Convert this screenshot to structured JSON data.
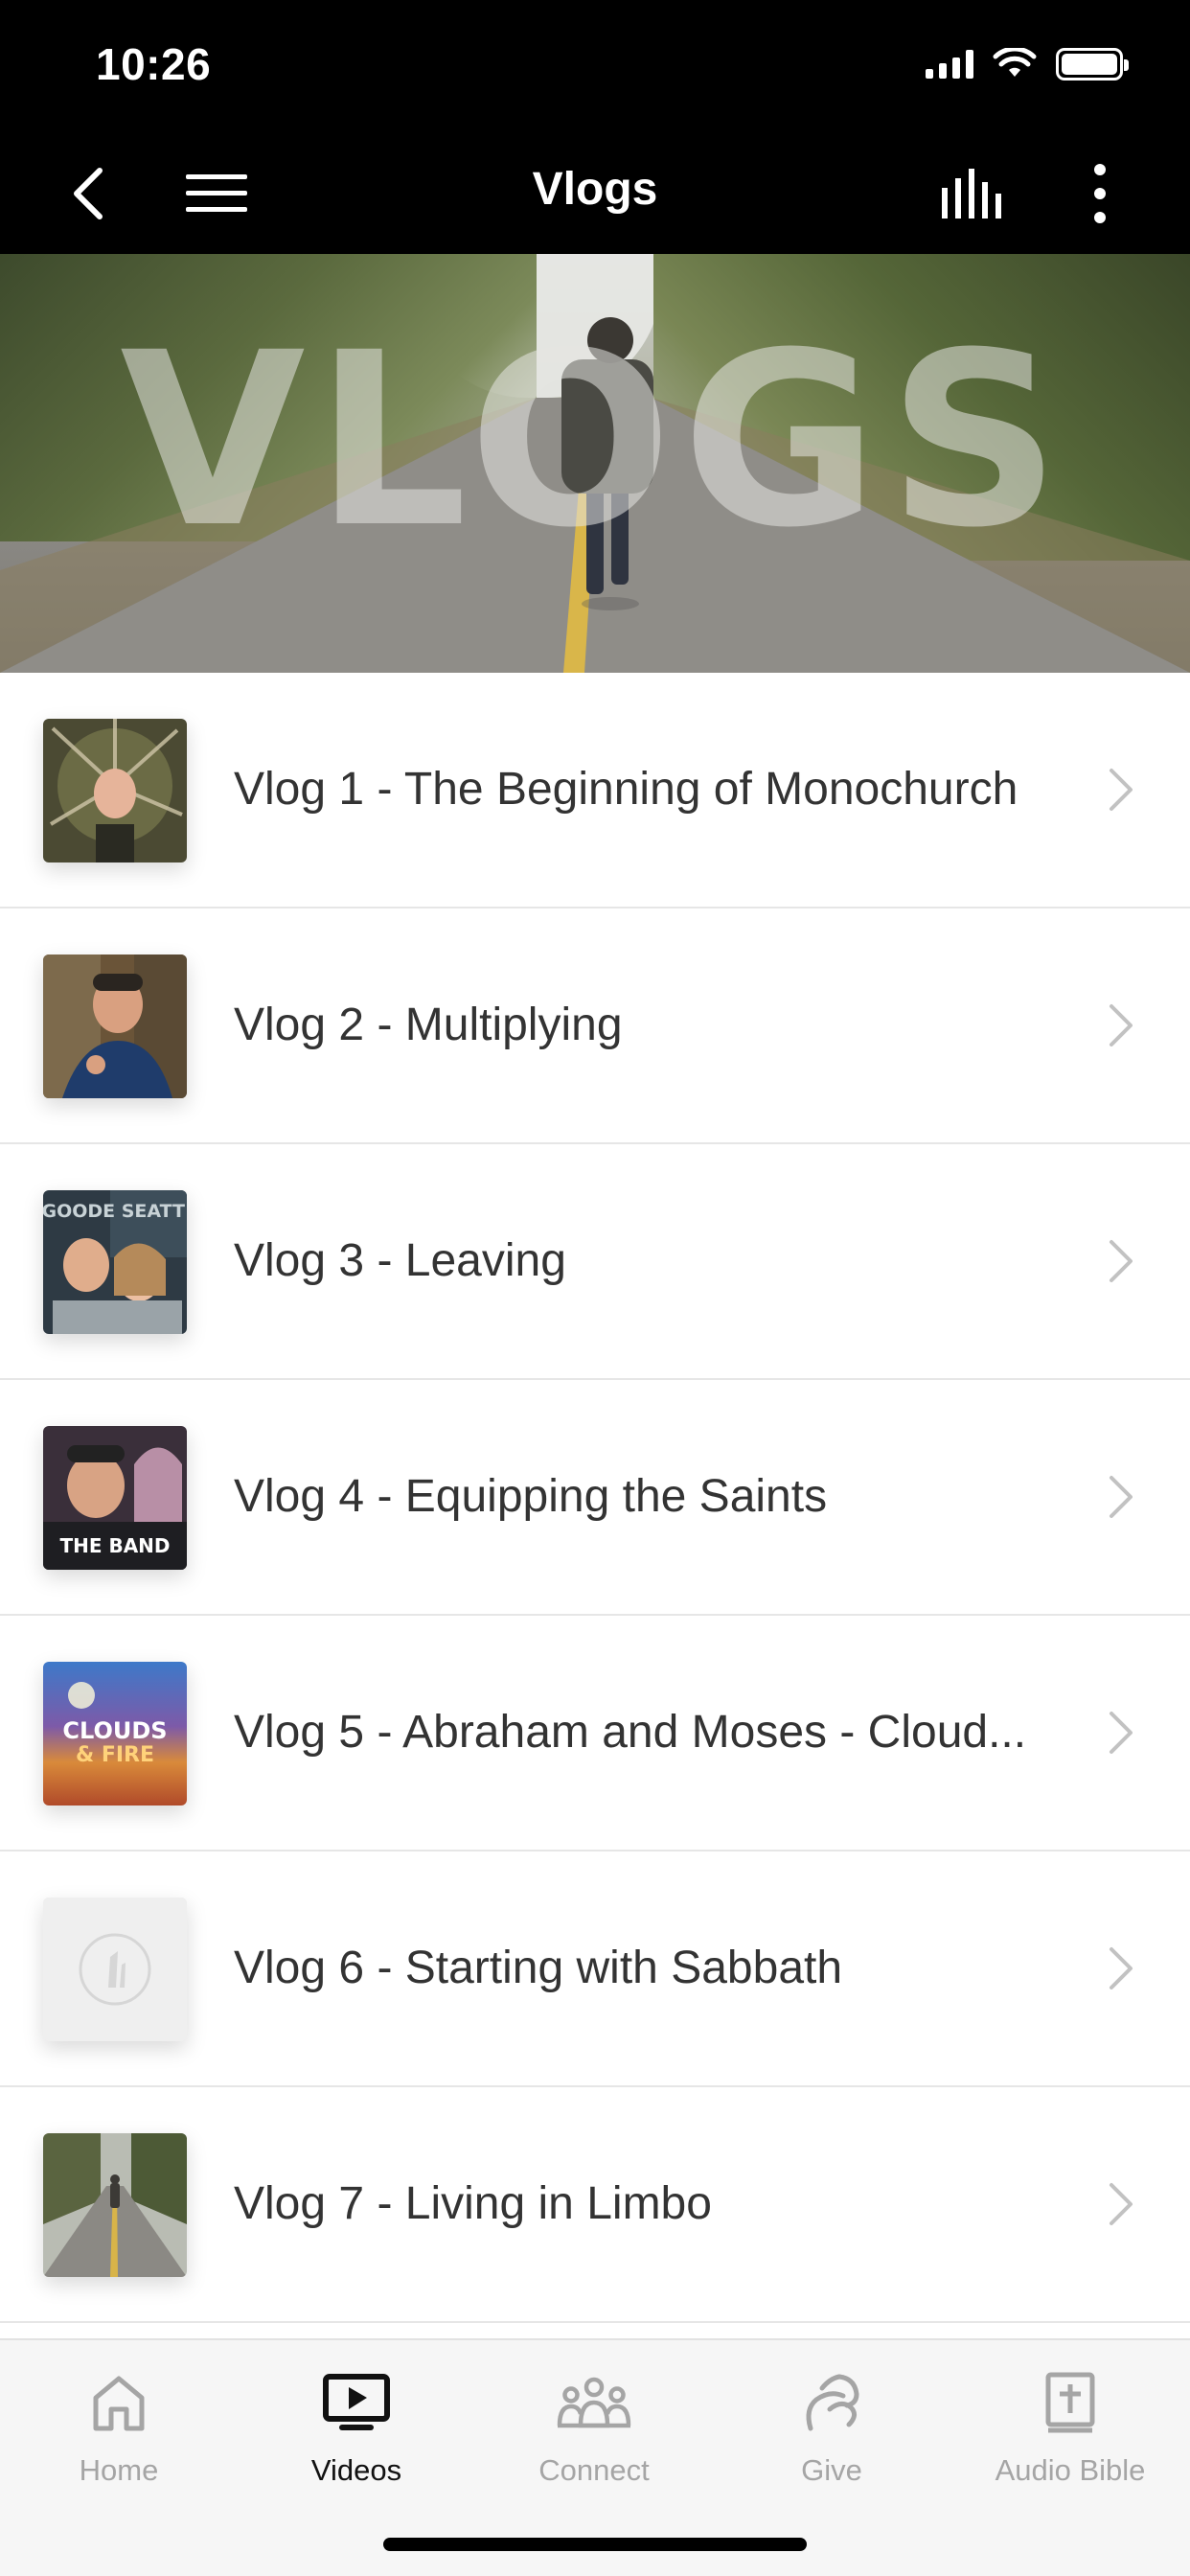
{
  "status_bar": {
    "time": "10:26"
  },
  "header": {
    "title": "Vlogs"
  },
  "hero": {
    "overlay_text": "VLOGS"
  },
  "list": {
    "items": [
      {
        "label": "Vlog 1 - The Beginning of Monochurch",
        "thumb": "tree-hands-photo"
      },
      {
        "label": "Vlog 2 - Multiplying",
        "thumb": "man-forest-photo"
      },
      {
        "label": "Vlog 3 - Leaving",
        "thumb": "couple-photo",
        "thumb_text": "GOODE SEATT"
      },
      {
        "label": "Vlog 4 - Equipping the Saints",
        "thumb": "man-church-photo",
        "thumb_text": "THE BAND"
      },
      {
        "label": "Vlog 5 - Abraham and Moses - Cloud...",
        "thumb": "clouds-fire-artwork",
        "thumb_text_1": "CLOUDS",
        "thumb_text_2": "& FIRE"
      },
      {
        "label": "Vlog 6 - Starting with Sabbath",
        "thumb": "placeholder-logo"
      },
      {
        "label": "Vlog 7 - Living in Limbo",
        "thumb": "road-walker-photo"
      }
    ]
  },
  "tabbar": {
    "tabs": [
      {
        "label": "Home",
        "icon": "home-icon",
        "active": false
      },
      {
        "label": "Videos",
        "icon": "tv-play-icon",
        "active": true
      },
      {
        "label": "Connect",
        "icon": "people-icon",
        "active": false
      },
      {
        "label": "Give",
        "icon": "give-icon",
        "active": false
      },
      {
        "label": "Audio Bible",
        "icon": "bible-icon",
        "active": false
      }
    ]
  },
  "colors": {
    "header_bg": "#000000",
    "active_tab": "#111111",
    "inactive_tab": "#a5a5a5",
    "divider": "#e6e6e6"
  }
}
